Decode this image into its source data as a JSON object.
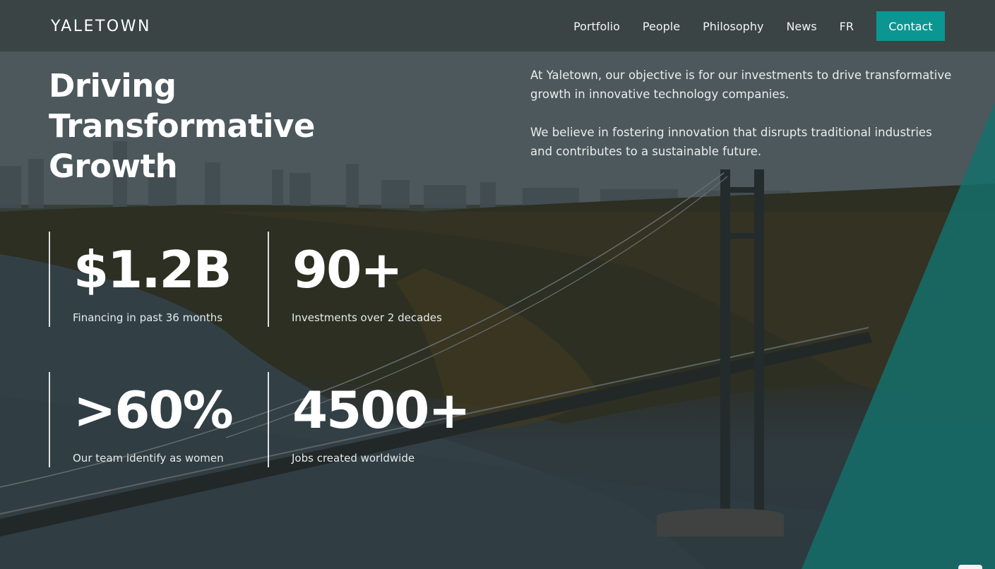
{
  "header": {
    "logo": "YALETOWN",
    "nav": [
      "Portfolio",
      "People",
      "Philosophy",
      "News",
      "FR"
    ],
    "contact_label": "Contact"
  },
  "hero": {
    "headline": [
      "Driving",
      "Transformative",
      "Growth"
    ],
    "intro": [
      "At Yaletown, our objective is for our investments to drive transformative growth in innovative technology companies.",
      "We believe in fostering innovation that disrupts traditional industries and contributes to a sustainable future."
    ]
  },
  "stats": [
    {
      "value": "$1.2B",
      "label": "Financing in past 36 months"
    },
    {
      "value": "90+",
      "label": "Investments over 2 decades"
    },
    {
      "value": ">60%",
      "label": "Our team identify as women"
    },
    {
      "value": "4500+",
      "label": "Jobs created worldwide"
    }
  ],
  "colors": {
    "accent": "#0b9692",
    "header_bg": "#373f40",
    "overlay_teal": "#1a6e6a"
  }
}
